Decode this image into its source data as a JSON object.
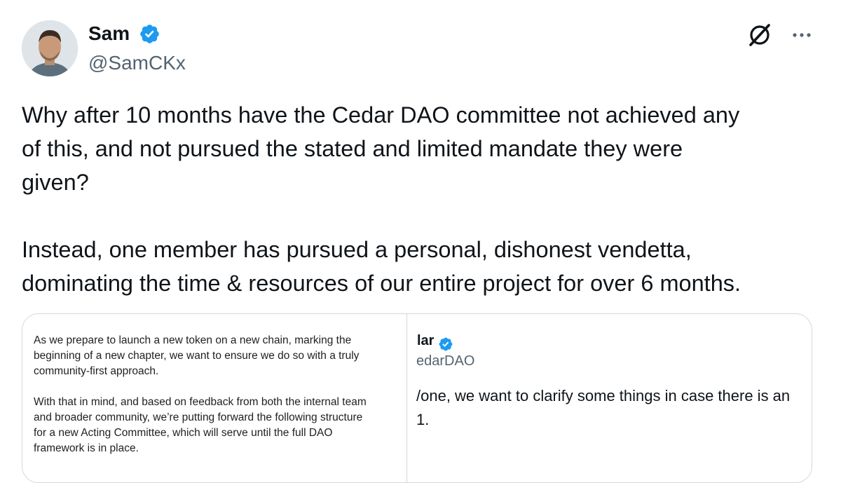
{
  "author": {
    "display_name": "Sam",
    "handle": "@SamCKx"
  },
  "icons": {
    "verified": "verified-badge-icon",
    "grok": "grok-icon",
    "more": "more-horizontal-icon"
  },
  "colors": {
    "verified": "#1d9bf0",
    "text": "#0f1419",
    "secondary": "#536471",
    "border": "#cfd9de"
  },
  "tweet": {
    "paragraphs": [
      "Why after 10 months have the Cedar DAO committee not achieved any\nof this, and not pursued the stated and limited mandate they were\ngiven?",
      "Instead, one member has pursued a personal, dishonest vendetta,\ndominating the time & resources of our entire project for over 6 months."
    ]
  },
  "media": {
    "left_image": {
      "paragraphs": [
        "As we prepare to launch a new token on a new chain, marking the\nbeginning of a new chapter, we want to ensure we do so with a truly\ncommunity-first approach.",
        "With that in mind, and based on feedback from both the internal team\nand broader community, we’re putting forward the following structure\nfor a new Acting Committee, which will serve until the full DAO\nframework is in place."
      ]
    },
    "right_image": {
      "name_fragment": "lar",
      "handle_fragment": "edarDAO",
      "text_fragment": "/one, we want to clarify some things in case there is an\n1."
    }
  }
}
